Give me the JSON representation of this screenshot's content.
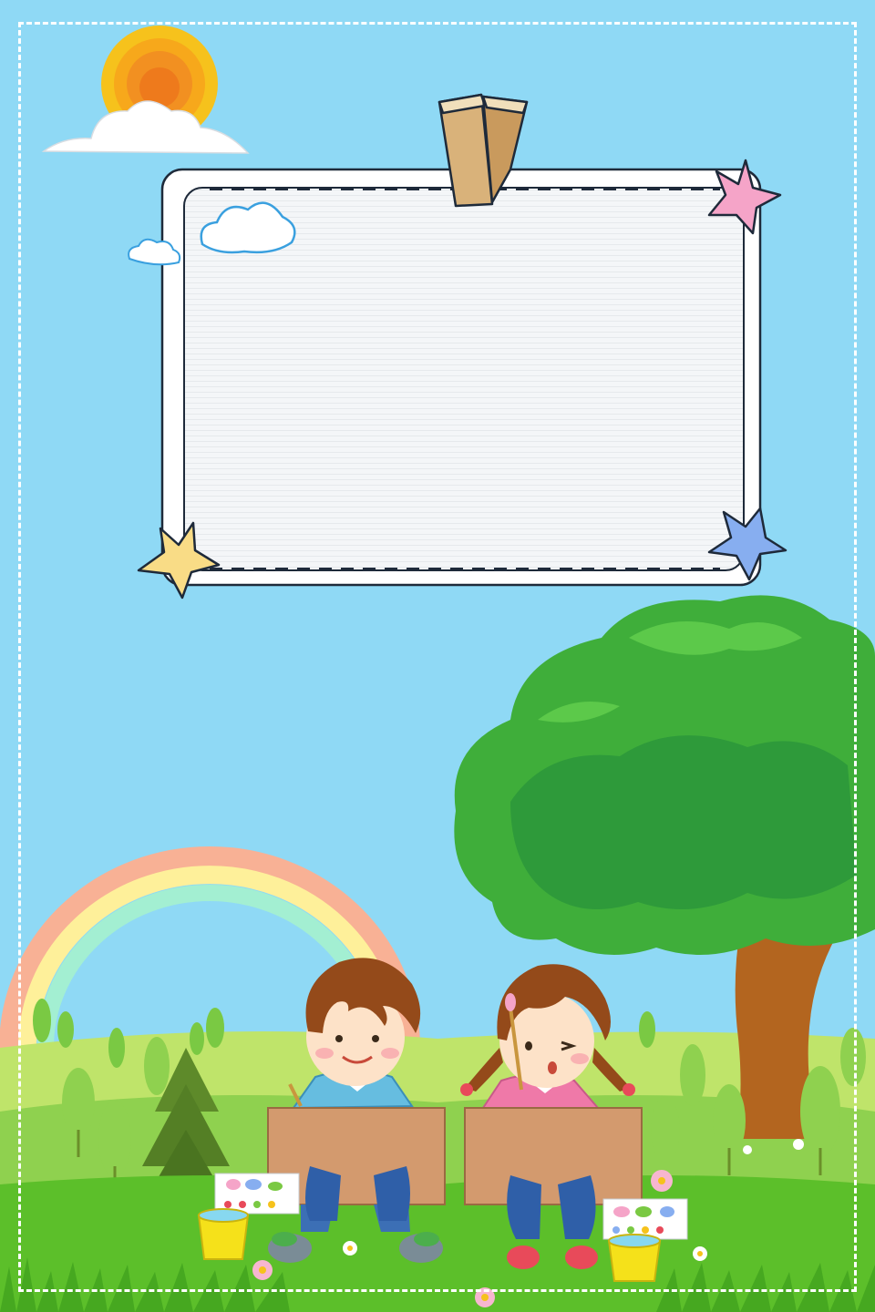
{
  "poster": {
    "palette": {
      "sky": "#8fd9f5",
      "frame_border": "#ffffff",
      "note_paper": "#f4f6f8",
      "note_outline": "#1e2a3a",
      "sun_outer": "#f6c21c",
      "sun_inner": "#ee7a1c",
      "grass_light": "#bfe46a",
      "grass_dark": "#5cbf2a",
      "tree_canopy": "#3fae3a",
      "tree_trunk": "#b3651f",
      "boy_shirt": "#66bde0",
      "girl_shirt": "#ef79a8",
      "easel": "#d39a6e",
      "paint_bucket": "#f5e11a"
    },
    "decorations": {
      "sun": "sun-icon",
      "clouds": [
        "cloud-icon",
        "cloud-icon",
        "cloud-icon"
      ],
      "stars": [
        "pink-star-icon",
        "yellow-star-icon",
        "blue-star-icon"
      ],
      "clip": "binder-clip-icon",
      "rainbow": "rainbow-icon",
      "tree": "big-tree-icon",
      "pine": "pine-tree-icon",
      "children": [
        "boy-painting-icon",
        "girl-painting-icon"
      ],
      "props": [
        "paint-palette-icon",
        "paint-palette-icon",
        "paint-bucket-icon",
        "paint-bucket-icon",
        "flower-icon"
      ]
    }
  }
}
